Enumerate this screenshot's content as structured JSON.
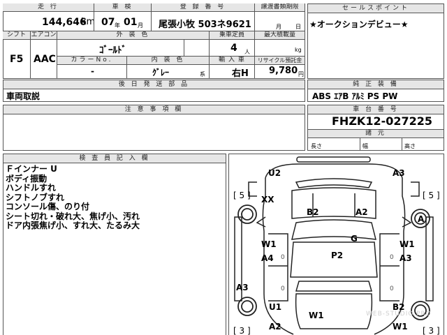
{
  "top": {
    "mileage_label": "走 行",
    "mileage_value": "144,646",
    "mileage_unit": "km",
    "inspection_label": "車 検",
    "inspection_year": "07",
    "inspection_year_unit": "年",
    "inspection_month": "01",
    "inspection_month_unit": "月",
    "reg_label": "登 録 番 号",
    "reg_value": "尾張小牧 503ネ9621",
    "transfer_label": "譲渡書類期限",
    "transfer_month_unit": "月",
    "transfer_day_unit": "日",
    "sales_label": "セールスポイント",
    "sales_value": "★オークションデビュー★"
  },
  "row2": {
    "shift_label": "シフト",
    "shift_value": "F5",
    "aircon_label": "エアコン",
    "aircon_value": "AAC",
    "exterior_label": "外 装 色",
    "exterior_value": "ｺﾞｰﾙﾄﾞ",
    "capacity_label": "乗車定員",
    "capacity_value": "4",
    "capacity_unit": "人",
    "load_label": "最大積載量",
    "load_unit": "kg",
    "colorno_label": "カラーNo.",
    "colorno_value": "-",
    "interior_label": "内 装 色",
    "interior_value": "ｸﾞﾚｰ",
    "interior_unit": "系",
    "import_label": "輸 入 車",
    "import_value": "右H",
    "recycle_label": "リサイクル預託金",
    "recycle_value": "9,780",
    "recycle_unit": "円"
  },
  "equipment": {
    "header": "純 正 装 備",
    "value": "ABS ｴｱB ｱﾙﾐ PS PW"
  },
  "delivered": {
    "header": "後 日 発 送 部 品",
    "value": "車両取説"
  },
  "caution": {
    "header": "注 意 事 項 欄",
    "value": ""
  },
  "chassis": {
    "header": "車 台 番 号",
    "value": "FHZK12-027225",
    "dims_header": "諸 元",
    "length_label": "長さ",
    "width_label": "幅",
    "height_label": "高さ"
  },
  "inspector": {
    "header": "検 査 員 記 入 欄",
    "lines": [
      "Ｆインナー U",
      "ボディ振動",
      "ハンドルすれ",
      "シフトノブすれ",
      "コンソール傷、のり付",
      "シート切れ・破れ大、焦げ小、汚れ",
      "ドア内張焦げ小、すれ大、たるみ大"
    ]
  },
  "diagram": {
    "labels": {
      "u2": "U2",
      "a3_top": "A3",
      "five_left": "[ 5 ]",
      "five_right": "[ 5 ]",
      "xx": "XX",
      "b2_top": "B2",
      "a2_top": "A2",
      "a_right": "A",
      "g": "G",
      "w1_left": "W1",
      "w1_right": "W1",
      "p2": "P2",
      "a4": "A4",
      "a3_right": "A3",
      "a3_left": "A3",
      "u1": "U1",
      "b2_bottom": "B2",
      "w1_bottom": "W1",
      "a2_bottom": "A2",
      "w1_bottom_right": "W1",
      "three_left": "[ 3 ]",
      "three_right": "[ 3 ]",
      "zero": "0"
    },
    "watermark": "WEB-STUDIO.PRO"
  }
}
